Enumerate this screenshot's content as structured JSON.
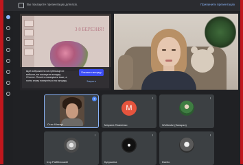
{
  "topbar": {
    "notice": "Вы показуєте презентацію для всіх.",
    "stop_label": "Припинити презентацію"
  },
  "slide": {
    "heading": "З 8 БЕРЕЗНЯ!",
    "caption_text": "Щоб зображення на публікації не вийшли, ви показуєте вкладку Chrome. Почніть показувати інше, а потім знову поверніться на вкладку.",
    "primary_button": "Показати вкладку",
    "secondary_button": "Закрити"
  },
  "participants": [
    {
      "name": "Стас Шакарі"
    },
    {
      "name": "Марина Павленко",
      "initial": "M"
    },
    {
      "name": "Wolfowitz (Захарко)"
    },
    {
      "name": "Ігор Райбінський"
    },
    {
      "name": "Кукушкіна"
    },
    {
      "name": "Danilo"
    }
  ],
  "colors": {
    "accent": "#8ab4f8",
    "frame_red": "#c0171d",
    "avatar_orange": "#e5543d",
    "button_blue": "#3c4df5"
  },
  "icons": {
    "present": "present-icon",
    "mic_off": "mic-off-icon",
    "pin": "pin-icon"
  }
}
